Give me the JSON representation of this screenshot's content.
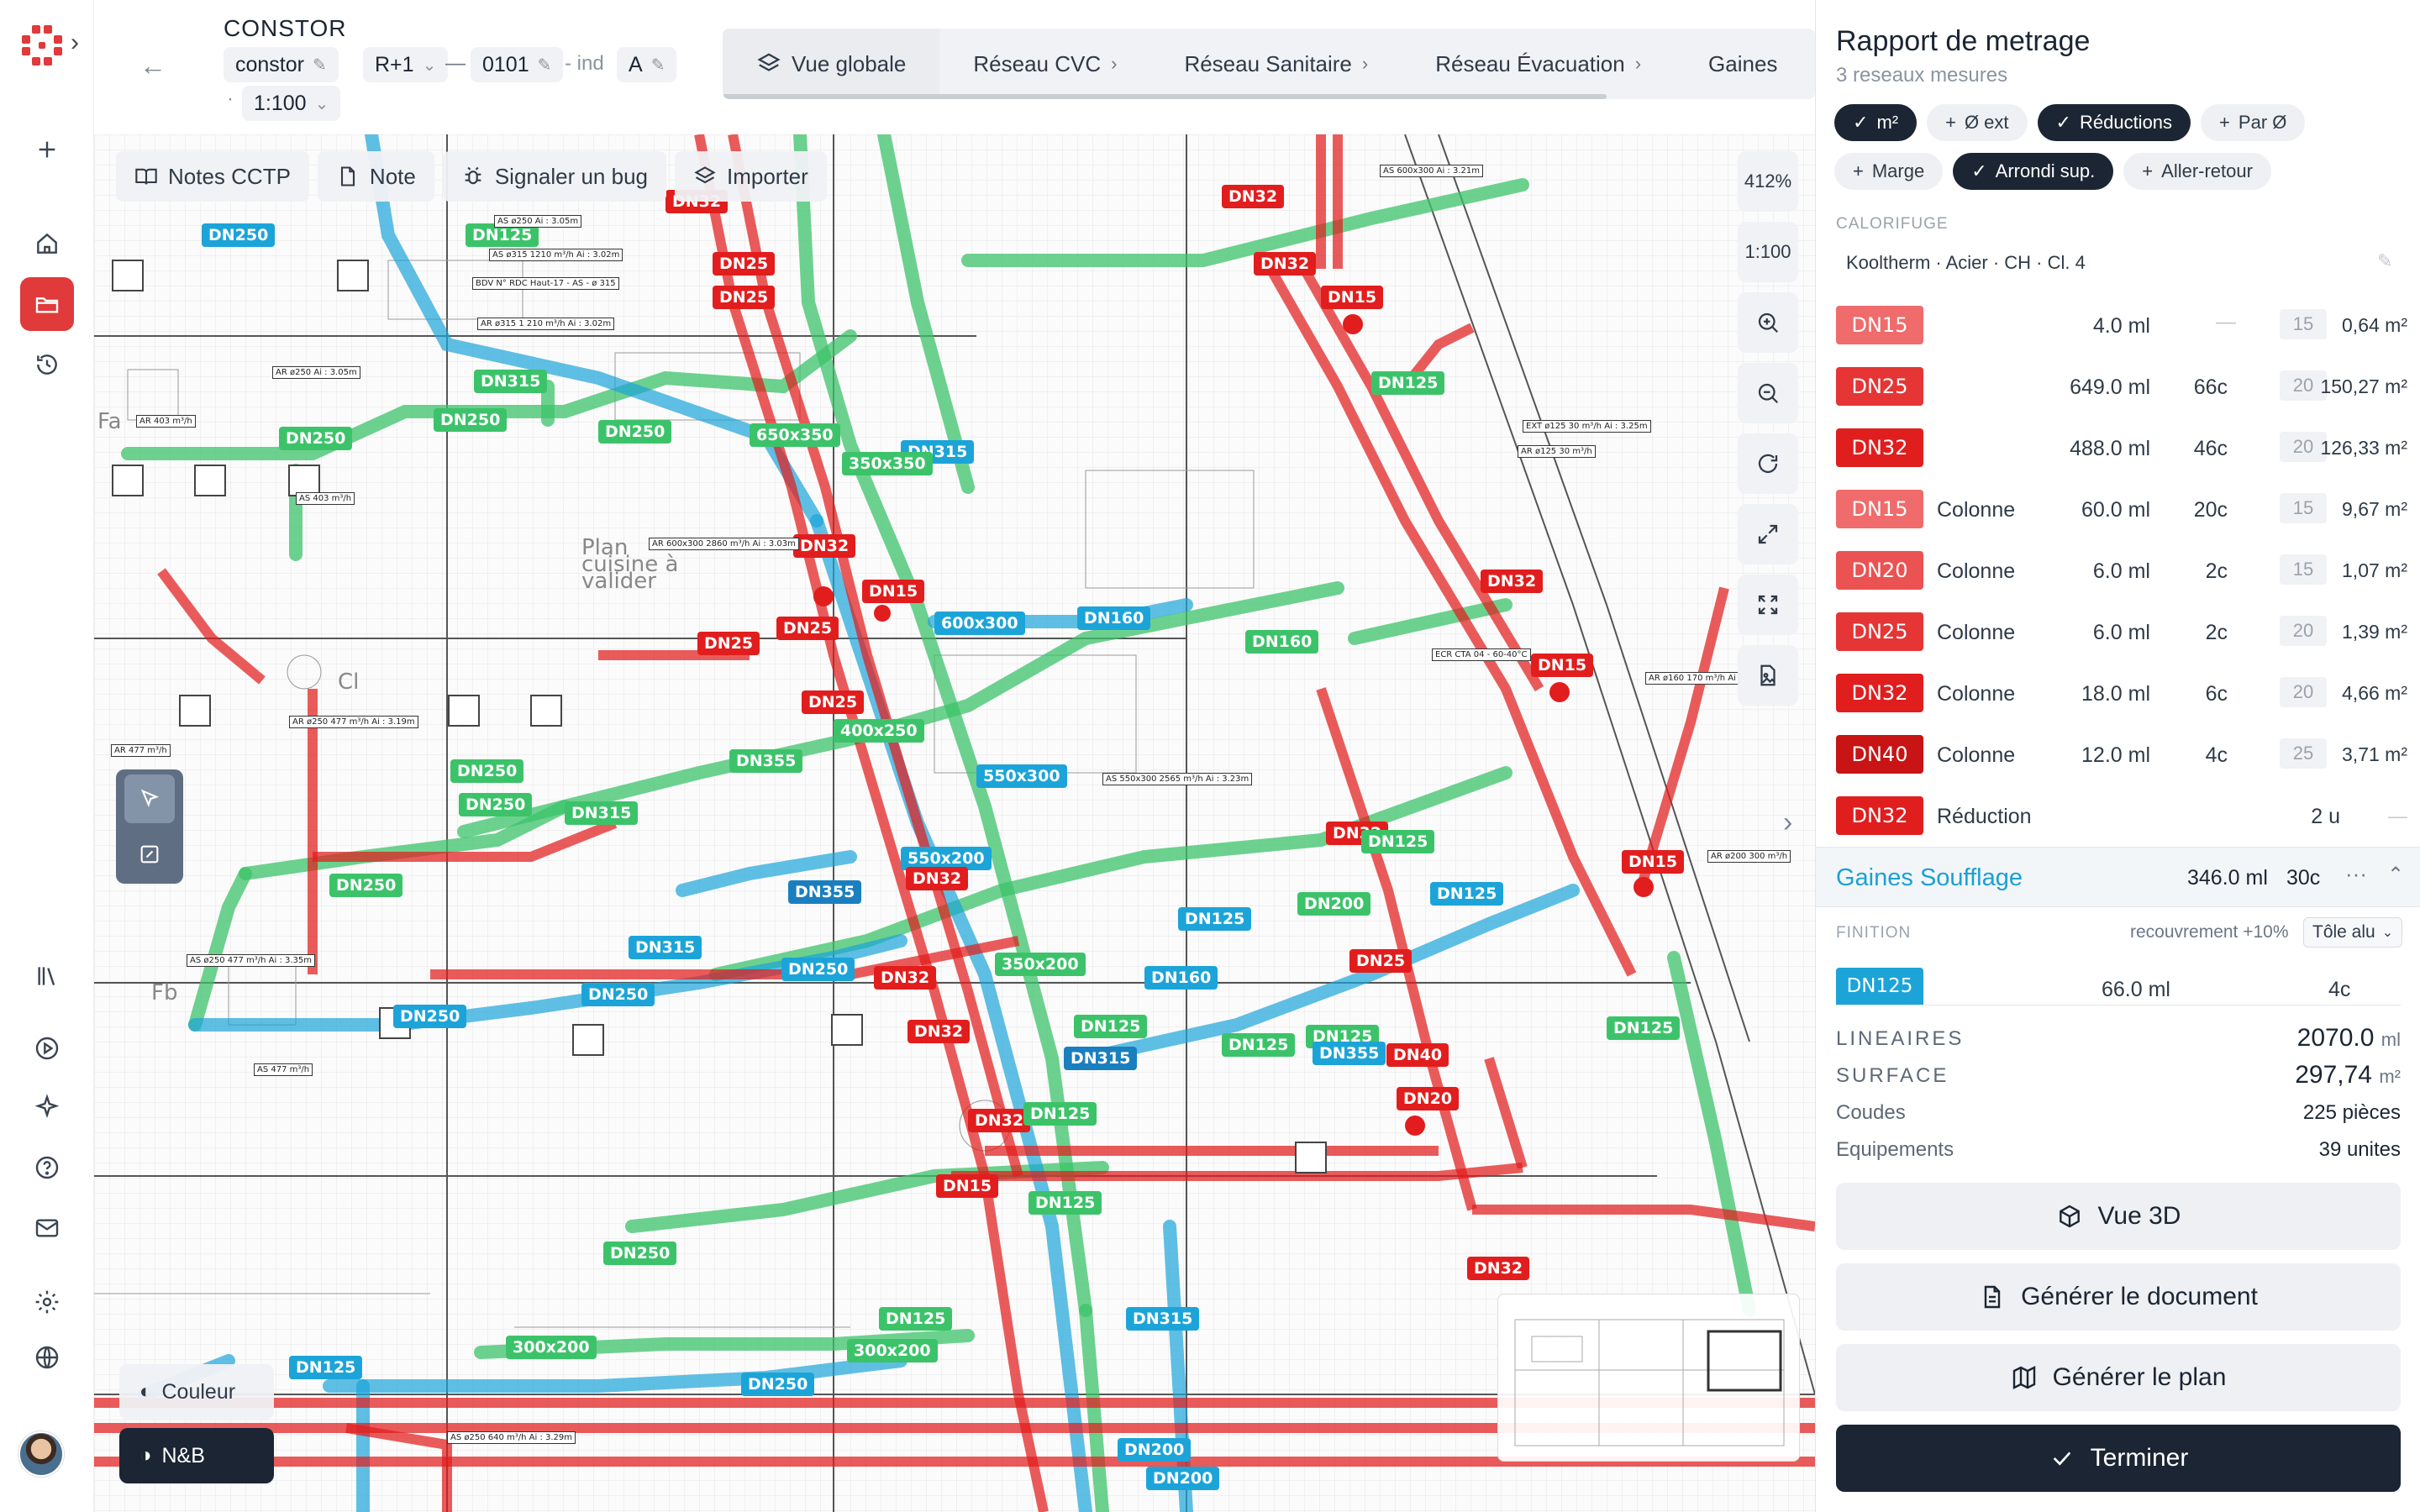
{
  "header": {
    "project_name": "CONSTOR",
    "project_chip": "constor",
    "level_chip": "R+1",
    "dash": "—",
    "sheet_chip": "0101",
    "ind_label": "- ind",
    "ind_value": "A",
    "scale_dot": "·",
    "scale_chip": "1:100"
  },
  "tabs": [
    {
      "label": "Vue globale"
    },
    {
      "label": "Réseau CVC"
    },
    {
      "label": "Réseau Sanitaire"
    },
    {
      "label": "Réseau Évacuation"
    },
    {
      "label": "Gaines"
    }
  ],
  "canvas": {
    "buttons": {
      "notes": "Notes CCTP",
      "note": "Note",
      "bug": "Signaler un bug",
      "import": "Importer"
    },
    "zoom": {
      "level": "412%",
      "scale": "1:100"
    },
    "view": {
      "color": "Couleur",
      "bw": "N&B"
    },
    "duct_labels": {
      "red": [
        "DN32",
        "DN25",
        "DN25",
        "DN32",
        "DN15",
        "DN32",
        "DN32",
        "DN25",
        "DN25",
        "DN15",
        "DN32",
        "DN15",
        "DN25",
        "DN32",
        "DN32",
        "DN32",
        "DN32",
        "DN25",
        "DN40",
        "DN20",
        "DN32",
        "DN15",
        "DN15",
        "DN32",
        "DN25"
      ],
      "blue": [
        "DN250",
        "DN315",
        "DN160",
        "600x300",
        "550x300",
        "550x200",
        "DN355",
        "DN315",
        "DN250",
        "DN250",
        "DN250",
        "DN125",
        "DN160",
        "DN315",
        "DN125",
        "DN125",
        "DN315",
        "DN250",
        "DN200",
        "DN200",
        "DN125"
      ],
      "green": [
        "DN125",
        "DN125",
        "DN315",
        "DN250",
        "DN250",
        "650x350",
        "350x350",
        "DN250",
        "DN160",
        "DN250",
        "DN250",
        "DN315",
        "DN355",
        "400x250",
        "DN250",
        "DN200",
        "DN125",
        "350x200",
        "DN125",
        "DN125",
        "DN125",
        "DN125",
        "DN125",
        "DN125",
        "DN250",
        "300x200",
        "DN125"
      ],
      "dblue": [
        "DN315",
        "DN355"
      ]
    },
    "notes": [
      "AS ø250 Ai : 3.05m",
      "AS ø315 1210 m³/h Ai : 3.02m",
      "BDV N° RDC Haut-17 - AS - ø 315",
      "AR ø250 Ai : 3.05m",
      "AR 403 m³/h",
      "AR ø315 1 210 m³/h Ai : 3.02m",
      "AS 403 m³/h",
      "AR ø250 477 m³/h Ai : 3.19m",
      "AR 477 m³/h",
      "AS ø250 477 m³/h Ai : 3.35m",
      "AS 477 m³/h",
      "AR 600x300 2860 m³/h Ai : 3.03m",
      "AR ø125 30 m³/h",
      "AS ø250 640 m³/h Ai : 3.29m",
      "EXT ø125 30 m³/h Ai : 3.25m",
      "AR ø160 170 m³/h Ai",
      "AR ø200 300 m³/h",
      "ECR CTA 04 - 60-40°C",
      "AS 550x300 2565 m³/h Ai : 3.23m",
      "AS 600x300 Ai : 3.21m"
    ]
  },
  "panel": {
    "title": "Rapport de metrage",
    "subtitle": "3 reseaux mesures",
    "pills": [
      {
        "label": "m²",
        "on": true,
        "icon": "check"
      },
      {
        "label": "Ø ext",
        "on": false,
        "icon": "plus"
      },
      {
        "label": "Réductions",
        "on": true,
        "icon": "check"
      },
      {
        "label": "Par Ø",
        "on": false,
        "icon": "plus"
      },
      {
        "label": "Marge",
        "on": false,
        "icon": "plus"
      },
      {
        "label": "Arrondi sup.",
        "on": true,
        "icon": "check"
      },
      {
        "label": "Aller-retour",
        "on": false,
        "icon": "plus"
      }
    ],
    "calorifuge_label": "CALORIFUGE",
    "calorifuge_value": "Kooltherm · Acier · CH · Cl. 4",
    "rows": [
      {
        "dn": "DN15",
        "color": "#f06b6b",
        "kind": "",
        "len": "4.0 ml",
        "cnt": "",
        "dash": "—",
        "thick": "15",
        "surf": "0,64 m²"
      },
      {
        "dn": "DN25",
        "color": "#e53535",
        "kind": "",
        "len": "649.0 ml",
        "cnt": "66c",
        "dash": "",
        "thick": "20",
        "surf": "150,27 m²"
      },
      {
        "dn": "DN32",
        "color": "#e01e1e",
        "kind": "",
        "len": "488.0 ml",
        "cnt": "46c",
        "dash": "",
        "thick": "20",
        "surf": "126,33 m²"
      },
      {
        "dn": "DN15",
        "color": "#f06b6b",
        "kind": "Colonne",
        "len": "60.0 ml",
        "cnt": "20c",
        "dash": "",
        "thick": "15",
        "surf": "9,67 m²"
      },
      {
        "dn": "DN20",
        "color": "#eb5252",
        "kind": "Colonne",
        "len": "6.0 ml",
        "cnt": "2c",
        "dash": "",
        "thick": "15",
        "surf": "1,07 m²"
      },
      {
        "dn": "DN25",
        "color": "#e53535",
        "kind": "Colonne",
        "len": "6.0 ml",
        "cnt": "2c",
        "dash": "",
        "thick": "20",
        "surf": "1,39 m²"
      },
      {
        "dn": "DN32",
        "color": "#e01e1e",
        "kind": "Colonne",
        "len": "18.0 ml",
        "cnt": "6c",
        "dash": "",
        "thick": "20",
        "surf": "4,66 m²"
      },
      {
        "dn": "DN40",
        "color": "#c81414",
        "kind": "Colonne",
        "len": "12.0 ml",
        "cnt": "4c",
        "dash": "",
        "thick": "25",
        "surf": "3,71 m²"
      },
      {
        "dn": "DN32",
        "color": "#e01e1e",
        "kind": "Réduction",
        "len": "",
        "cnt": "",
        "dash": "",
        "thick": "",
        "surf": "",
        "units": "2 u",
        "enddash": "—"
      }
    ],
    "gaines": {
      "title": "Gaines Soufflage",
      "len": "346.0 ml",
      "cnt": "30c",
      "more": "···",
      "collapse": "⌃"
    },
    "finition": {
      "label": "FINITION",
      "recouv": "recouvrement +10%",
      "material": "Tôle alu"
    },
    "dn125_row": {
      "dn": "DN125",
      "len": "66.0 ml",
      "cnt": "4c"
    },
    "summary": {
      "lineaires_label": "LINEAIRES",
      "lineaires_value": "2070.0",
      "lineaires_unit": "ml",
      "surface_label": "SURFACE",
      "surface_value": "297,74",
      "surface_unit": "m²",
      "coudes_label": "Coudes",
      "coudes_value": "225 pièces",
      "equip_label": "Equipements",
      "equip_value": "39 unites"
    },
    "actions": {
      "view3d": "Vue 3D",
      "generate_doc": "Générer le document",
      "generate_plan": "Générer le plan",
      "finish": "Terminer"
    }
  }
}
